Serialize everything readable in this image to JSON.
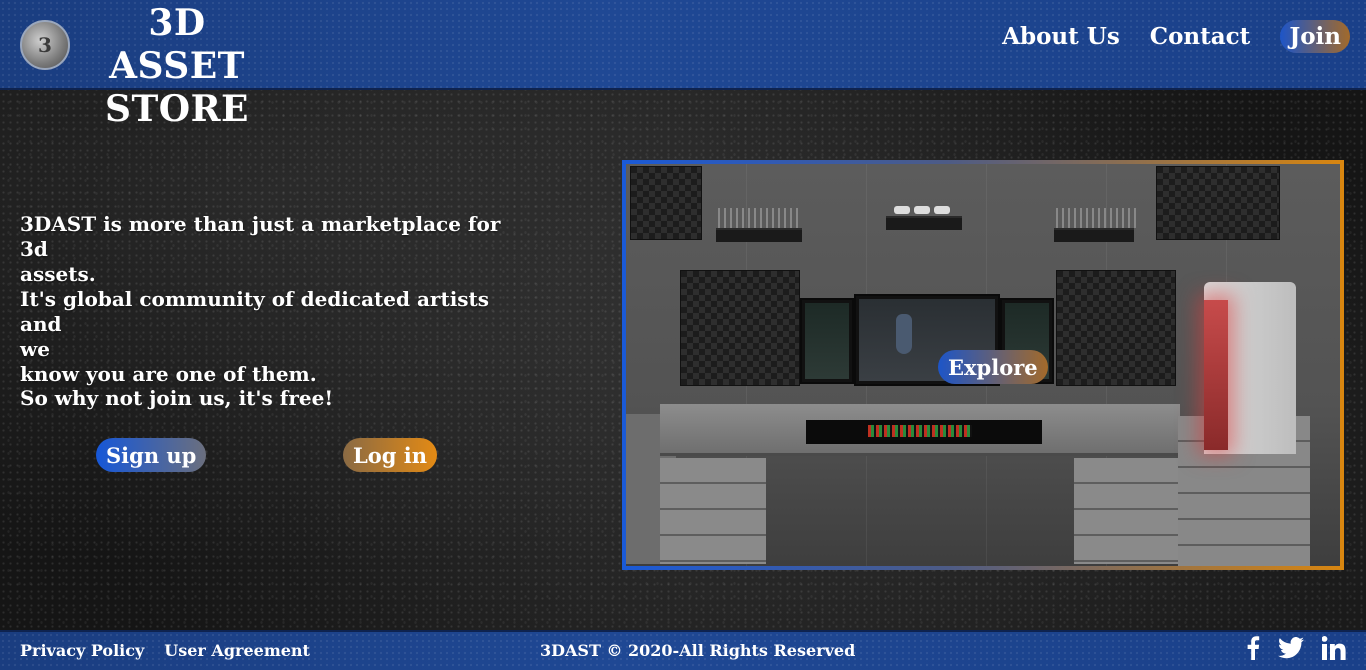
{
  "header": {
    "logo_glyph": "3",
    "title": "3D ASSET STORE",
    "nav": {
      "about": "About Us",
      "contact": "Contact",
      "join": "Join"
    }
  },
  "hero": {
    "line1": "3DAST is more than just a marketplace for 3d",
    "line2": "assets.",
    "line3": "It's global community of dedicated artists and",
    "line4": "we",
    "line5": "know you are one of them.",
    "cta": "So why not join us, it's free!",
    "signup": "Sign up",
    "login": "Log in"
  },
  "showcase": {
    "explore": "Explore"
  },
  "footer": {
    "privacy": "Privacy Policy",
    "agreement": "User Agreement",
    "copyright": "3DAST © 2020-All Rights Reserved",
    "social_icons": [
      "facebook-icon",
      "twitter-icon",
      "linkedin-icon"
    ]
  },
  "colors": {
    "header_blue": "#1f4894",
    "accent_blue": "#1a5ad8",
    "accent_orange": "#d9860f"
  }
}
